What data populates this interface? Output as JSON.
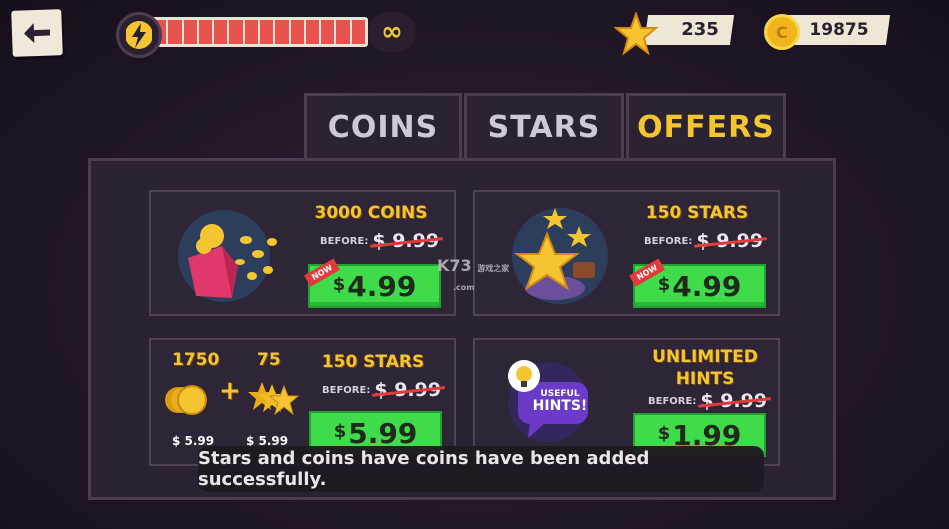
{
  "header": {
    "energy_infinity": "∞",
    "stars": "235",
    "coins": "19875",
    "coin_symbol": "C"
  },
  "tabs": [
    {
      "label": "COINS",
      "active": false
    },
    {
      "label": "STARS",
      "active": false
    },
    {
      "label": "OFFERS",
      "active": true
    }
  ],
  "offers": [
    {
      "title": "3000 COINS",
      "before_label": "BEFORE:",
      "old_price": "9.99",
      "currency": "$",
      "price": "4.99",
      "badge": "NOW"
    },
    {
      "title": "150 STARS",
      "before_label": "BEFORE:",
      "old_price": "9.99",
      "currency": "$",
      "price": "4.99",
      "badge": "NOW"
    },
    {
      "title": "150 STARS",
      "before_label": "BEFORE:",
      "old_price": "9.99",
      "currency": "$",
      "price": "5.99",
      "bundle": {
        "coins_qty": "1750",
        "coins_price": "$ 5.99",
        "plus": "+",
        "stars_qty": "75",
        "stars_price": "$ 5.99"
      }
    },
    {
      "title_line1": "UNLIMITED",
      "title_line2": "HINTS",
      "before_label": "BEFORE:",
      "old_price": "9.99",
      "currency": "$",
      "price": "1.99",
      "hint_bubble_line1": "USEFUL",
      "hint_bubble_line2": "HINTS!"
    }
  ],
  "toast": "Stars and coins have coins have been added successfully.",
  "watermark": {
    "main": "K73",
    "sub1": "游戏之家",
    "sub2": ".com"
  },
  "colors": {
    "accent_yellow": "#f4c530",
    "buy_green": "#3fdb4a",
    "energy_red": "#e8524f",
    "panel_bg": "#2b2232"
  }
}
